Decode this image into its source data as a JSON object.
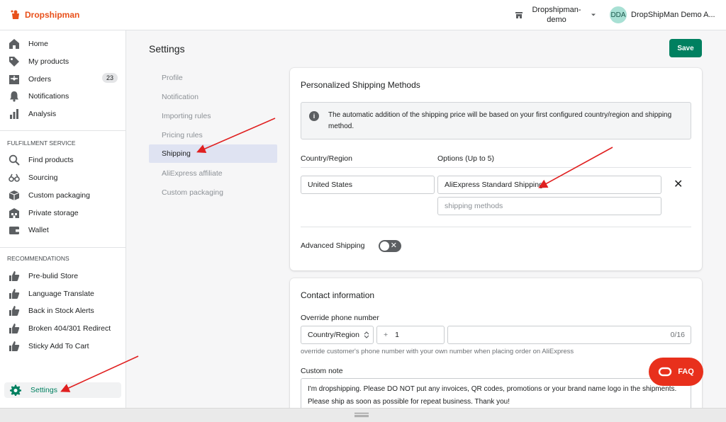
{
  "app": {
    "logo_text": "Dropshipman",
    "store_name": "Dropshipman-demo",
    "user_initials": "DDA",
    "user_name": "DropShipMan Demo A..."
  },
  "sidebar": {
    "main_items": [
      {
        "label": "Home",
        "icon": "home-icon"
      },
      {
        "label": "My products",
        "icon": "tag-icon"
      },
      {
        "label": "Orders",
        "icon": "orders-icon",
        "badge": "23"
      },
      {
        "label": "Notifications",
        "icon": "bell-icon"
      },
      {
        "label": "Analysis",
        "icon": "bar-chart-icon"
      }
    ],
    "fulfillment_title": "FULFILLMENT SERVICE",
    "fulfillment_items": [
      {
        "label": "Find products",
        "icon": "search-icon"
      },
      {
        "label": "Sourcing",
        "icon": "binoculars-icon"
      },
      {
        "label": "Custom packaging",
        "icon": "package-icon"
      },
      {
        "label": "Private storage",
        "icon": "warehouse-icon"
      },
      {
        "label": "Wallet",
        "icon": "wallet-icon"
      }
    ],
    "recommendations_title": "RECOMMENDATIONS",
    "recommendation_items": [
      {
        "label": "Pre-bulid Store",
        "icon": "thumbs-up-icon"
      },
      {
        "label": "Language Translate",
        "icon": "thumbs-up-icon"
      },
      {
        "label": "Back in Stock Alerts",
        "icon": "thumbs-up-icon"
      },
      {
        "label": "Broken 404/301 Redirect",
        "icon": "thumbs-up-icon"
      },
      {
        "label": "Sticky Add To Cart",
        "icon": "thumbs-up-icon"
      }
    ],
    "settings_label": "Settings"
  },
  "page": {
    "title": "Settings",
    "save_label": "Save"
  },
  "settings_nav": [
    {
      "label": "Profile",
      "active": false
    },
    {
      "label": "Notification",
      "active": false
    },
    {
      "label": "Importing rules",
      "active": false
    },
    {
      "label": "Pricing rules",
      "active": false
    },
    {
      "label": "Shipping",
      "active": true
    },
    {
      "label": "AliExpress affiliate",
      "active": false
    },
    {
      "label": "Custom packaging",
      "active": false
    }
  ],
  "shipping_card": {
    "title": "Personalized Shipping Methods",
    "banner_text": "The automatic addition of the shipping price will be based on your first configured country/region and shipping method.",
    "country_header": "Country/Region",
    "options_header": "Options (Up to 5)",
    "country_value": "United States",
    "option_value": "AliExpress Standard Shipping",
    "option_placeholder": "shipping methods",
    "advanced_label": "Advanced Shipping",
    "advanced_enabled": false
  },
  "contact_card": {
    "title": "Contact information",
    "phone_label": "Override phone number",
    "country_select": "Country/Region",
    "dial_prefix": "+",
    "dial_code": "1",
    "phone_value": "",
    "phone_counter": "0/16",
    "phone_help": "override customer's phone number with your own number when placing order on AliExpress",
    "note_label": "Custom note",
    "note_value": "I'm dropshipping. Please DO NOT put any invoices, QR codes, promotions or your brand name logo in the shipments. Please ship as soon as possible for repeat business. Thank you!"
  },
  "faq": {
    "label": "FAQ"
  },
  "colors": {
    "primary_green": "#008060",
    "brand_orange": "#e8501a",
    "faq_red": "#e8301c",
    "annotation_red": "#e02020"
  }
}
